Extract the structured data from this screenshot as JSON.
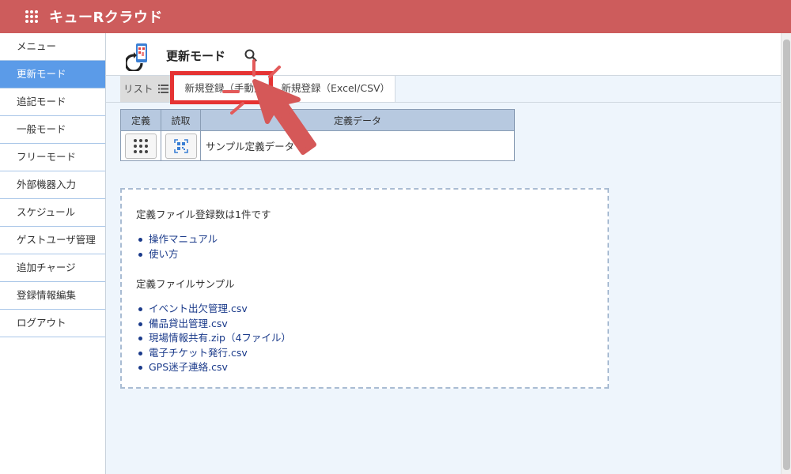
{
  "app": {
    "title": "キューRクラウド",
    "accent": "#cd5c5c"
  },
  "sidebar": {
    "items": [
      {
        "label": "メニュー",
        "active": false
      },
      {
        "label": "更新モード",
        "active": true
      },
      {
        "label": "追記モード",
        "active": false
      },
      {
        "label": "一般モード",
        "active": false
      },
      {
        "label": "フリーモード",
        "active": false
      },
      {
        "label": "外部機器入力",
        "active": false
      },
      {
        "label": "スケジュール",
        "active": false
      },
      {
        "label": "ゲストユーザ管理",
        "active": false
      },
      {
        "label": "追加チャージ",
        "active": false
      },
      {
        "label": "登録情報編集",
        "active": false
      },
      {
        "label": "ログアウト",
        "active": false
      }
    ],
    "active_color": "#5b9be8"
  },
  "header": {
    "title": "更新モード",
    "mode_icon": "phone-qr-refresh-icon",
    "search_icon": "search-icon"
  },
  "tabs": {
    "list": "リスト",
    "manual": "新規登録（手動）",
    "excel": "新規登録（Excel/CSV）"
  },
  "table": {
    "headers": [
      "定義",
      "読取",
      "定義データ"
    ],
    "rows": [
      {
        "definition_icon": "grid-dots-icon",
        "read_icon": "qr-scan-icon",
        "name": "サンプル定義データ"
      }
    ]
  },
  "info": {
    "count_text": "定義ファイル登録数は1件です",
    "links": [
      "操作マニュアル",
      "使い方"
    ],
    "sample_heading": "定義ファイルサンプル",
    "samples": [
      "イベント出欠管理.csv",
      "備品貸出管理.csv",
      "現場情報共有.zip（4ファイル）",
      "電子チケット発行.csv",
      "GPS迷子連絡.csv"
    ]
  },
  "annotation": {
    "highlight_color": "#e53333",
    "pointer_color": "#d55858"
  }
}
